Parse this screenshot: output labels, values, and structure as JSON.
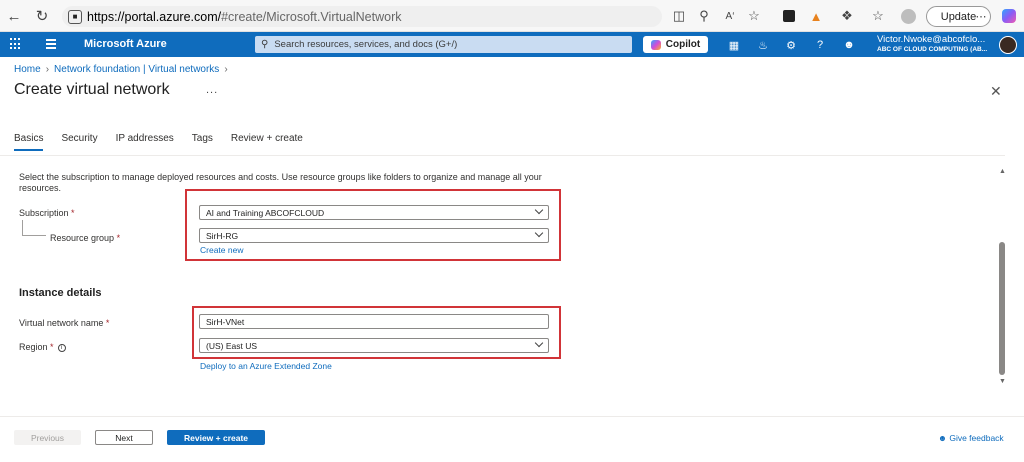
{
  "browser": {
    "url_host": "https://portal.azure.com/",
    "url_path": "#create/Microsoft.VirtualNetwork",
    "update_label": "Update",
    "toolbar_icons": [
      "back-icon",
      "refresh-icon",
      "split-view-icon",
      "zoom-icon",
      "read-aloud-icon",
      "favorite-icon",
      "extension-icon",
      "fox-extension-icon",
      "puzzle-icon",
      "favorites-icon",
      "profile-icon",
      "more-icon",
      "copilot-browser-icon"
    ]
  },
  "azure": {
    "brand": "Microsoft Azure",
    "search_placeholder": "Search resources, services, and docs (G+/)",
    "copilot_label": "Copilot",
    "user_name": "Victor.Nwoke@abcofclo...",
    "user_tenant": "ABC OF CLOUD COMPUTING (AB...",
    "accent": "#0f6cbd"
  },
  "breadcrumb": {
    "items": [
      "Home",
      "Network foundation | Virtual networks"
    ]
  },
  "page": {
    "title": "Create virtual network",
    "more": "...",
    "tabs": [
      "Basics",
      "Security",
      "IP addresses",
      "Tags",
      "Review + create"
    ],
    "active_tab": "Basics"
  },
  "form": {
    "intro": "Select the subscription to manage deployed resources and costs. Use resource groups like folders to organize and manage all your resources.",
    "subscription_label": "Subscription",
    "subscription_value": "AI and Training ABCOFCLOUD",
    "resource_group_label": "Resource group",
    "resource_group_value": "SirH-RG",
    "create_new": "Create new",
    "instance_heading": "Instance details",
    "vnet_name_label": "Virtual network name",
    "vnet_name_value": "SirH-VNet",
    "region_label": "Region",
    "region_value": "(US) East US",
    "extended_zone_link": "Deploy to an Azure Extended Zone",
    "required_marker": "*"
  },
  "footer": {
    "previous": "Previous",
    "next": "Next",
    "review": "Review + create",
    "feedback": "Give feedback"
  }
}
